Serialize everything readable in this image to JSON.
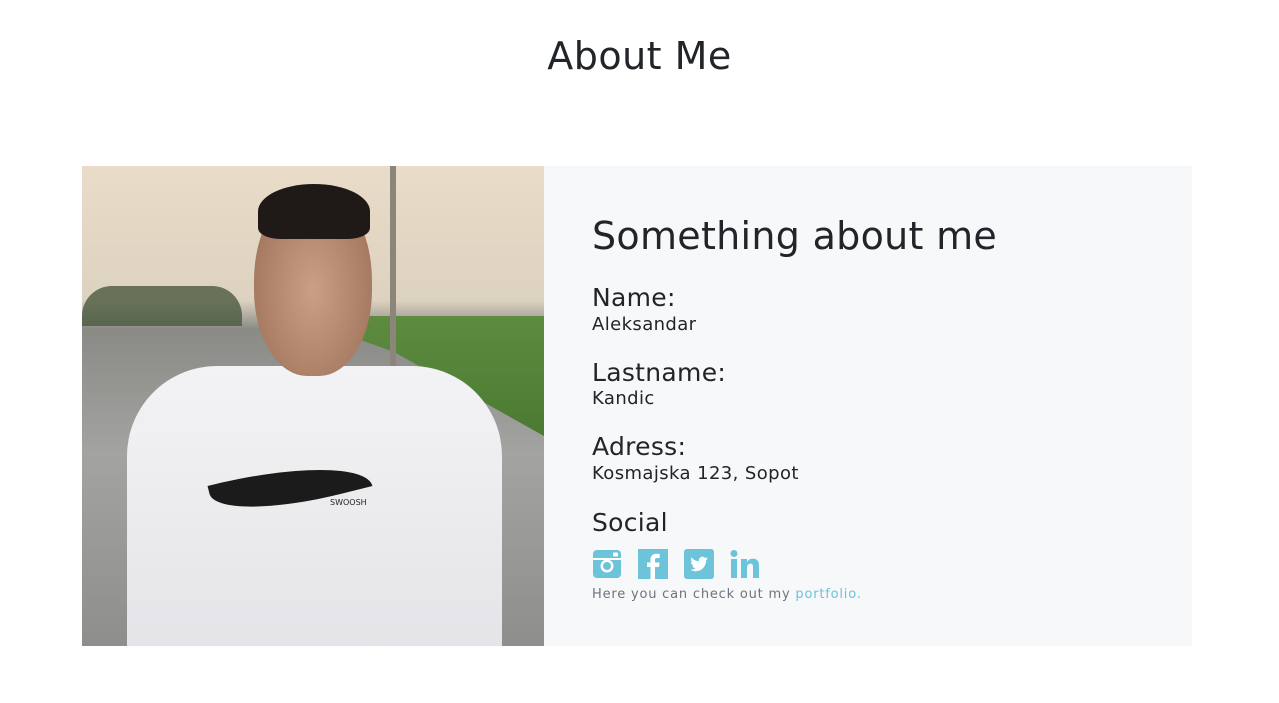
{
  "page": {
    "title": "About Me"
  },
  "about": {
    "heading": "Something about me",
    "fields": [
      {
        "label": "Name:",
        "value": "Aleksandar"
      },
      {
        "label": "Lastname:",
        "value": "Kandic"
      },
      {
        "label": "Adress:",
        "value": "Kosmajska 123, Sopot"
      }
    ],
    "social_label": "Social",
    "social_icons": [
      "instagram-icon",
      "facebook-icon",
      "twitter-icon",
      "linkedin-icon"
    ],
    "footer_prefix": "Here you can check out my",
    "footer_link": "portfolio.",
    "photo_text": "SWOOSH"
  },
  "colors": {
    "accent": "#6cc3da",
    "card_bg": "#f7f8fa",
    "text": "#212529"
  }
}
